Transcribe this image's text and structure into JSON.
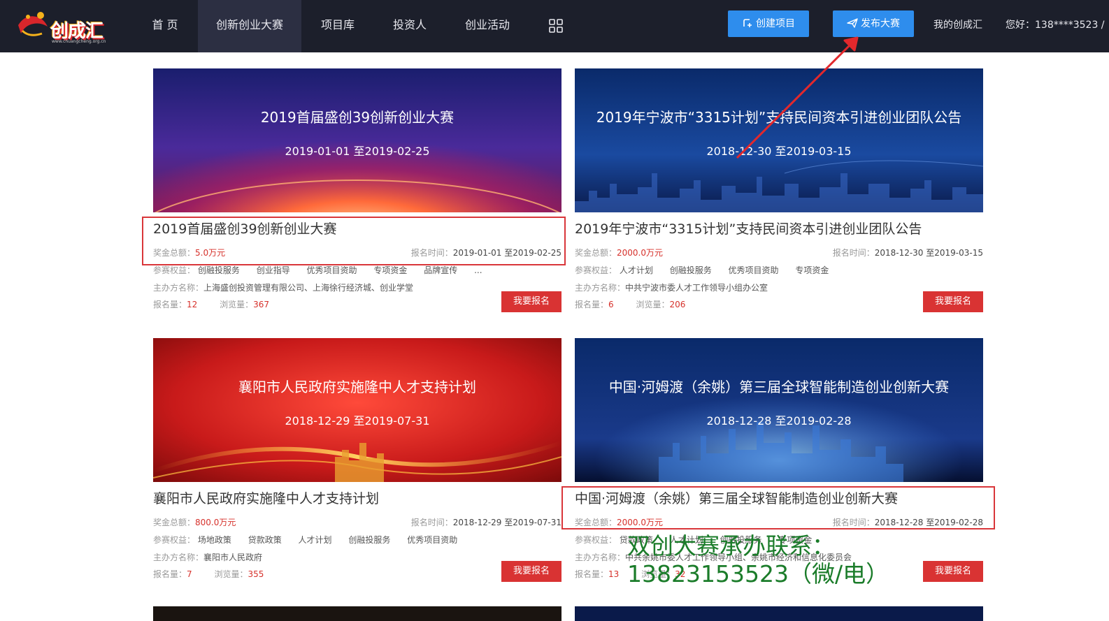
{
  "logo": {
    "text": "创成汇",
    "sub": "www.chuangcheng.org.cn"
  },
  "nav": [
    {
      "label": "首 页",
      "active": false
    },
    {
      "label": "创新创业大赛",
      "active": true
    },
    {
      "label": "项目库",
      "active": false
    },
    {
      "label": "投资人",
      "active": false
    },
    {
      "label": "创业活动",
      "active": false
    }
  ],
  "header": {
    "create_project": "创建项目",
    "publish_contest": "发布大赛",
    "my_account": "我的创成汇",
    "greeting": "您好：138****3523 /"
  },
  "labels": {
    "prize": "奖金总额：",
    "reg_time": "报名时间：",
    "benefits": "参赛权益：",
    "organizer": "主办方名称：",
    "signups": "报名量：",
    "views": "浏览量：",
    "signup_button": "我要报名"
  },
  "cards": [
    {
      "banner_title": "2019首届盛创39创新创业大赛",
      "banner_date": "2019-01-01 至2019-02-25",
      "title": "2019首届盛创39创新创业大赛",
      "prize": "5.0万元",
      "reg_time": "2019-01-01 至2019-02-25",
      "benefits": [
        "创融投服务",
        "创业指导",
        "优秀项目资助",
        "专项资金",
        "品牌宣传",
        "..."
      ],
      "organizer": "上海盛创投资管理有限公司、上海徐行经济城、创业学堂",
      "signups": "12",
      "views": "367"
    },
    {
      "banner_title": "2019年宁波市“3315计划”支持民间资本引进创业团队公告",
      "banner_date": "2018-12-30 至2019-03-15",
      "title": "2019年宁波市“3315计划”支持民间资本引进创业团队公告",
      "prize": "2000.0万元",
      "reg_time": "2018-12-30 至2019-03-15",
      "benefits": [
        "人才计划",
        "创融投服务",
        "优秀项目资助",
        "专项资金"
      ],
      "organizer": "中共宁波市委人才工作领导小组办公室",
      "signups": "6",
      "views": "206"
    },
    {
      "banner_title": "襄阳市人民政府实施隆中人才支持计划",
      "banner_date": "2018-12-29 至2019-07-31",
      "title": "襄阳市人民政府实施隆中人才支持计划",
      "prize": "800.0万元",
      "reg_time": "2018-12-29 至2019-07-31",
      "benefits": [
        "场地政策",
        "贷款政策",
        "人才计划",
        "创融投服务",
        "优秀项目资助"
      ],
      "organizer": "襄阳市人民政府",
      "signups": "7",
      "views": "355"
    },
    {
      "banner_title": "中国·河姆渡（余姚）第三届全球智能制造创业创新大赛",
      "banner_date": "2018-12-28 至2019-02-28",
      "title": "中国·河姆渡（余姚）第三届全球智能制造创业创新大赛",
      "prize": "2000.0万元",
      "reg_time": "2018-12-28 至2019-02-28",
      "benefits": [
        "贷款政策",
        "人才计划",
        "创融投服务",
        "专项资金"
      ],
      "organizer": "中共余姚市委人才工作领导小组、余姚市经济和信息化委员会",
      "signups": "13",
      "views": "32"
    }
  ],
  "overlay": {
    "line1": "双创大赛承办联系：",
    "line2": "13823153523（微/电）"
  },
  "colors": {
    "topbar": "#1c1f2b",
    "accent_blue": "#2e8ded",
    "signup_red": "#d93333",
    "highlight_red": "#d9363a",
    "overlay_green": "#1b7c2a"
  }
}
